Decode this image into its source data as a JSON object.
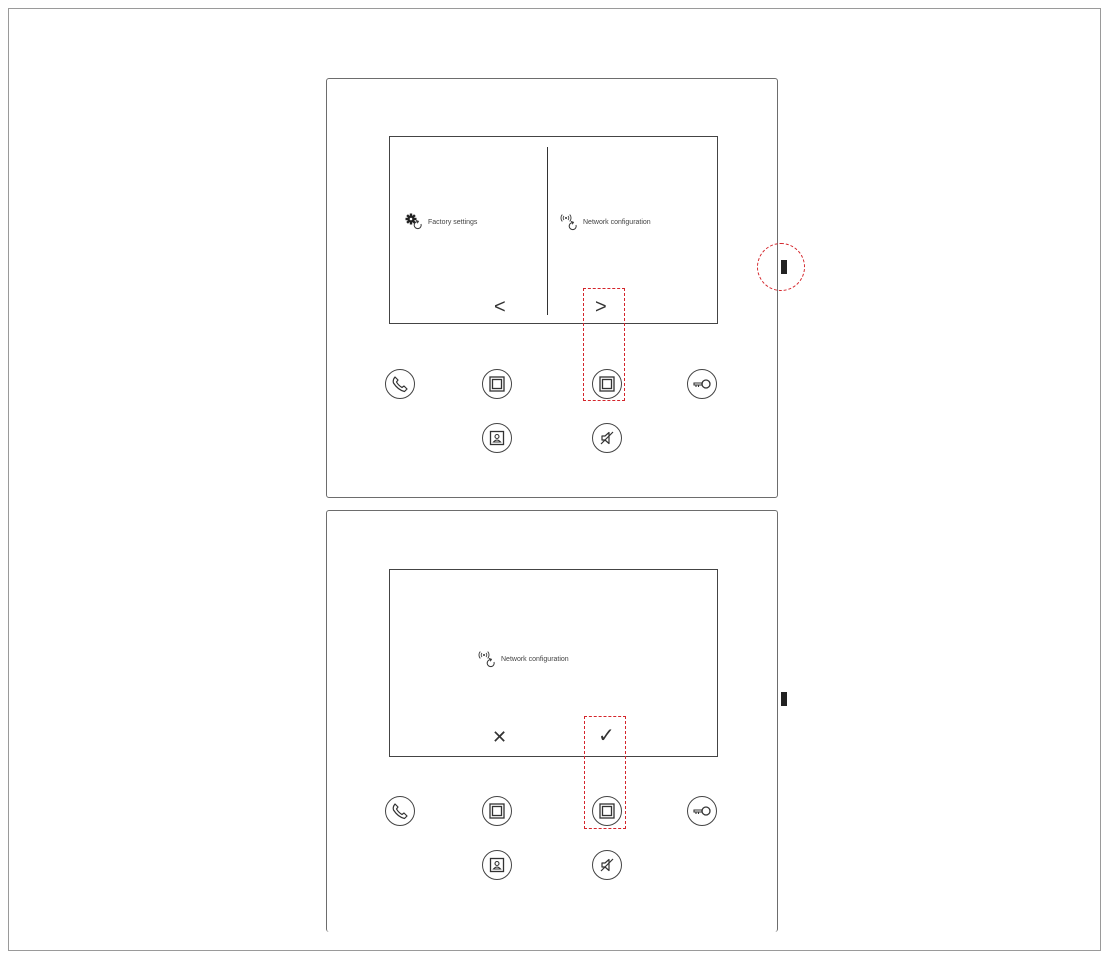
{
  "panel1": {
    "left_item": {
      "icon": "gear-icon",
      "label": "Factory settings"
    },
    "right_item": {
      "icon": "wireless-icon",
      "label": "Network configuration"
    },
    "prev_glyph": "<",
    "next_glyph": ">"
  },
  "panel2": {
    "item": {
      "icon": "wireless-icon",
      "label": "Network configuration"
    },
    "cancel_glyph": "✕",
    "confirm_glyph": "✓"
  },
  "buttons": [
    "phone-icon",
    "square-button-icon",
    "square-button-icon",
    "key-icon",
    "monitor-icon",
    "mute-icon"
  ],
  "colors": {
    "highlight": "#d4252b",
    "line": "#444444"
  }
}
